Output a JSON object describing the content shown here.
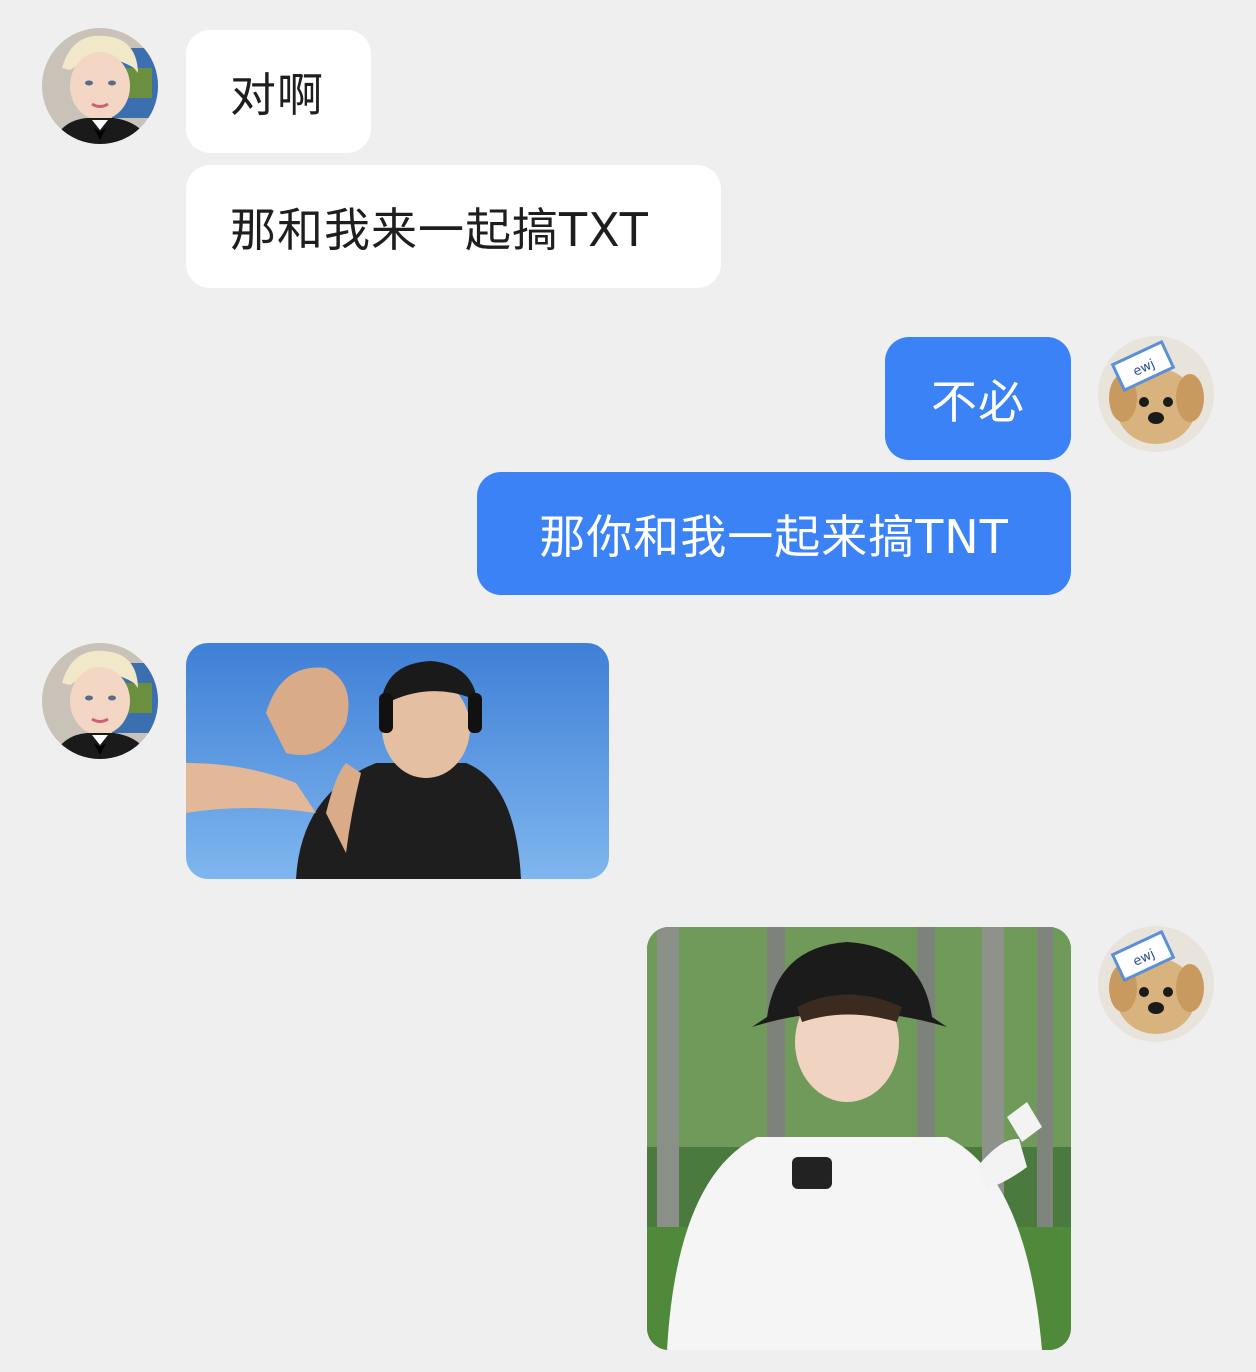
{
  "messages": [
    {
      "side": "incoming",
      "type": "text",
      "text": "对啊"
    },
    {
      "side": "incoming",
      "type": "text",
      "text": "那和我来一起搞TXT"
    },
    {
      "side": "outgoing",
      "type": "text",
      "text": "不必"
    },
    {
      "side": "outgoing",
      "type": "text",
      "text": "那你和我一起来搞TNT"
    },
    {
      "side": "incoming",
      "type": "image",
      "description_icon": "sticker-photo-icon"
    },
    {
      "side": "outgoing",
      "type": "image",
      "description_icon": "sticker-photo-icon"
    }
  ],
  "avatars": {
    "contact": {
      "icon": "contact-avatar-icon"
    },
    "self": {
      "icon": "dog-avatar-icon"
    }
  },
  "colors": {
    "background": "#efefef",
    "incoming_bubble": "#ffffff",
    "outgoing_bubble": "#3b82f6",
    "incoming_text": "#1e1e1e",
    "outgoing_text": "#ffffff"
  }
}
